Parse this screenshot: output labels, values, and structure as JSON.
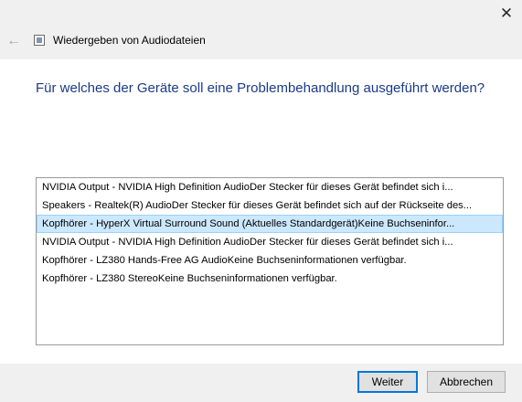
{
  "window": {
    "title": "Wiedergeben von Audiodateien",
    "close_glyph": "✕",
    "back_glyph": "←"
  },
  "main": {
    "heading": "Für welches der Geräte soll eine Problembehandlung ausgeführt werden?",
    "devices": [
      "NVIDIA Output - NVIDIA High Definition AudioDer Stecker für dieses Gerät befindet sich i...",
      "Speakers - Realtek(R) AudioDer Stecker für dieses Gerät befindet sich auf der Rückseite des...",
      "Kopfhörer - HyperX Virtual Surround Sound (Aktuelles Standardgerät)Keine Buchseninfor...",
      "NVIDIA Output - NVIDIA High Definition AudioDer Stecker für dieses Gerät befindet sich i...",
      "Kopfhörer - LZ380 Hands-Free AG AudioKeine Buchseninformationen verfügbar.",
      "Kopfhörer - LZ380 StereoKeine Buchseninformationen verfügbar."
    ],
    "selected_index": 2
  },
  "footer": {
    "next_label": "Weiter",
    "cancel_label": "Abbrechen"
  },
  "colors": {
    "heading": "#1a3a8a",
    "selection": "#cce8ff",
    "accent": "#0078d7"
  }
}
